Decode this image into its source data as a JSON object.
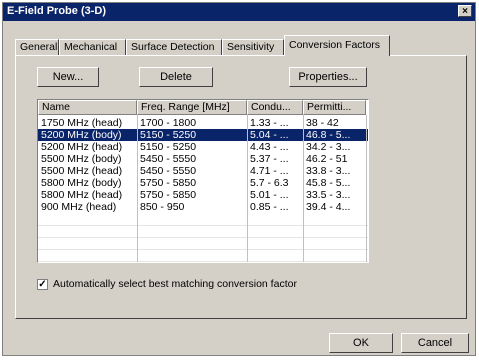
{
  "window": {
    "title": "E-Field Probe (3-D)",
    "close_glyph": "×"
  },
  "tabs": [
    {
      "label": "General"
    },
    {
      "label": "Mechanical"
    },
    {
      "label": "Surface Detection"
    },
    {
      "label": "Sensitivity"
    },
    {
      "label": "Conversion Factors",
      "active": true
    }
  ],
  "toolbar": {
    "new_label": "New...",
    "delete_label": "Delete",
    "properties_label": "Properties..."
  },
  "list": {
    "columns": [
      "Name",
      "Freq. Range [MHz]",
      "Condu...",
      "Permitti..."
    ],
    "rows": [
      [
        "1750 MHz (head)",
        "1700 - 1800",
        "1.33 - ...",
        "38 - 42"
      ],
      [
        "5200 MHz (body)",
        "5150 - 5250",
        "5.04 - ...",
        "46.8 - 5..."
      ],
      [
        "5200 MHz (head)",
        "5150 - 5250",
        "4.43 - ...",
        "34.2 - 3..."
      ],
      [
        "5500 MHz (body)",
        "5450 - 5550",
        "5.37 - ...",
        "46.2 - 51"
      ],
      [
        "5500 MHz (head)",
        "5450 - 5550",
        "4.71 - ...",
        "33.8 - 3..."
      ],
      [
        "5800 MHz (body)",
        "5750 - 5850",
        "5.7 - 6.3",
        "45.8 - 5..."
      ],
      [
        "5800 MHz (head)",
        "5750 - 5850",
        "5.01 - ...",
        "33.5 - 3..."
      ],
      [
        "900 MHz (head)",
        "850 - 950",
        "0.85 - ...",
        "39.4 - 4..."
      ]
    ],
    "selected_index": 1
  },
  "auto_select": {
    "label": "Automatically select best matching conversion factor",
    "checked": true,
    "check_glyph": "✓"
  },
  "footer": {
    "ok_label": "OK",
    "cancel_label": "Cancel"
  },
  "colors": {
    "title_bar": "#0a246a",
    "selection": "#0a246a",
    "face": "#d4d0c8"
  }
}
